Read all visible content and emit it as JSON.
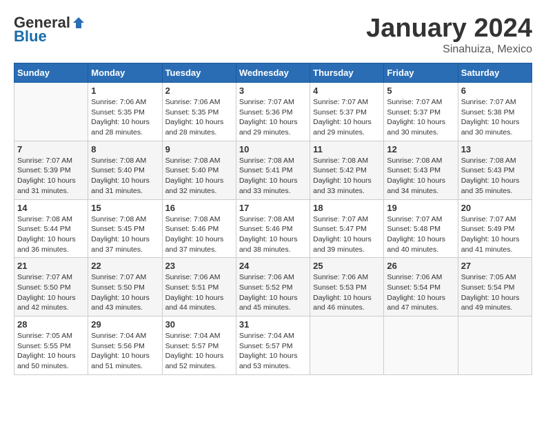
{
  "header": {
    "logo_general": "General",
    "logo_blue": "Blue",
    "month_year": "January 2024",
    "location": "Sinahuiza, Mexico"
  },
  "days_of_week": [
    "Sunday",
    "Monday",
    "Tuesday",
    "Wednesday",
    "Thursday",
    "Friday",
    "Saturday"
  ],
  "weeks": [
    [
      {
        "num": "",
        "sunrise": "",
        "sunset": "",
        "daylight": ""
      },
      {
        "num": "1",
        "sunrise": "Sunrise: 7:06 AM",
        "sunset": "Sunset: 5:35 PM",
        "daylight": "Daylight: 10 hours and 28 minutes."
      },
      {
        "num": "2",
        "sunrise": "Sunrise: 7:06 AM",
        "sunset": "Sunset: 5:35 PM",
        "daylight": "Daylight: 10 hours and 28 minutes."
      },
      {
        "num": "3",
        "sunrise": "Sunrise: 7:07 AM",
        "sunset": "Sunset: 5:36 PM",
        "daylight": "Daylight: 10 hours and 29 minutes."
      },
      {
        "num": "4",
        "sunrise": "Sunrise: 7:07 AM",
        "sunset": "Sunset: 5:37 PM",
        "daylight": "Daylight: 10 hours and 29 minutes."
      },
      {
        "num": "5",
        "sunrise": "Sunrise: 7:07 AM",
        "sunset": "Sunset: 5:37 PM",
        "daylight": "Daylight: 10 hours and 30 minutes."
      },
      {
        "num": "6",
        "sunrise": "Sunrise: 7:07 AM",
        "sunset": "Sunset: 5:38 PM",
        "daylight": "Daylight: 10 hours and 30 minutes."
      }
    ],
    [
      {
        "num": "7",
        "sunrise": "Sunrise: 7:07 AM",
        "sunset": "Sunset: 5:39 PM",
        "daylight": "Daylight: 10 hours and 31 minutes."
      },
      {
        "num": "8",
        "sunrise": "Sunrise: 7:08 AM",
        "sunset": "Sunset: 5:40 PM",
        "daylight": "Daylight: 10 hours and 31 minutes."
      },
      {
        "num": "9",
        "sunrise": "Sunrise: 7:08 AM",
        "sunset": "Sunset: 5:40 PM",
        "daylight": "Daylight: 10 hours and 32 minutes."
      },
      {
        "num": "10",
        "sunrise": "Sunrise: 7:08 AM",
        "sunset": "Sunset: 5:41 PM",
        "daylight": "Daylight: 10 hours and 33 minutes."
      },
      {
        "num": "11",
        "sunrise": "Sunrise: 7:08 AM",
        "sunset": "Sunset: 5:42 PM",
        "daylight": "Daylight: 10 hours and 33 minutes."
      },
      {
        "num": "12",
        "sunrise": "Sunrise: 7:08 AM",
        "sunset": "Sunset: 5:43 PM",
        "daylight": "Daylight: 10 hours and 34 minutes."
      },
      {
        "num": "13",
        "sunrise": "Sunrise: 7:08 AM",
        "sunset": "Sunset: 5:43 PM",
        "daylight": "Daylight: 10 hours and 35 minutes."
      }
    ],
    [
      {
        "num": "14",
        "sunrise": "Sunrise: 7:08 AM",
        "sunset": "Sunset: 5:44 PM",
        "daylight": "Daylight: 10 hours and 36 minutes."
      },
      {
        "num": "15",
        "sunrise": "Sunrise: 7:08 AM",
        "sunset": "Sunset: 5:45 PM",
        "daylight": "Daylight: 10 hours and 37 minutes."
      },
      {
        "num": "16",
        "sunrise": "Sunrise: 7:08 AM",
        "sunset": "Sunset: 5:46 PM",
        "daylight": "Daylight: 10 hours and 37 minutes."
      },
      {
        "num": "17",
        "sunrise": "Sunrise: 7:08 AM",
        "sunset": "Sunset: 5:46 PM",
        "daylight": "Daylight: 10 hours and 38 minutes."
      },
      {
        "num": "18",
        "sunrise": "Sunrise: 7:07 AM",
        "sunset": "Sunset: 5:47 PM",
        "daylight": "Daylight: 10 hours and 39 minutes."
      },
      {
        "num": "19",
        "sunrise": "Sunrise: 7:07 AM",
        "sunset": "Sunset: 5:48 PM",
        "daylight": "Daylight: 10 hours and 40 minutes."
      },
      {
        "num": "20",
        "sunrise": "Sunrise: 7:07 AM",
        "sunset": "Sunset: 5:49 PM",
        "daylight": "Daylight: 10 hours and 41 minutes."
      }
    ],
    [
      {
        "num": "21",
        "sunrise": "Sunrise: 7:07 AM",
        "sunset": "Sunset: 5:50 PM",
        "daylight": "Daylight: 10 hours and 42 minutes."
      },
      {
        "num": "22",
        "sunrise": "Sunrise: 7:07 AM",
        "sunset": "Sunset: 5:50 PM",
        "daylight": "Daylight: 10 hours and 43 minutes."
      },
      {
        "num": "23",
        "sunrise": "Sunrise: 7:06 AM",
        "sunset": "Sunset: 5:51 PM",
        "daylight": "Daylight: 10 hours and 44 minutes."
      },
      {
        "num": "24",
        "sunrise": "Sunrise: 7:06 AM",
        "sunset": "Sunset: 5:52 PM",
        "daylight": "Daylight: 10 hours and 45 minutes."
      },
      {
        "num": "25",
        "sunrise": "Sunrise: 7:06 AM",
        "sunset": "Sunset: 5:53 PM",
        "daylight": "Daylight: 10 hours and 46 minutes."
      },
      {
        "num": "26",
        "sunrise": "Sunrise: 7:06 AM",
        "sunset": "Sunset: 5:54 PM",
        "daylight": "Daylight: 10 hours and 47 minutes."
      },
      {
        "num": "27",
        "sunrise": "Sunrise: 7:05 AM",
        "sunset": "Sunset: 5:54 PM",
        "daylight": "Daylight: 10 hours and 49 minutes."
      }
    ],
    [
      {
        "num": "28",
        "sunrise": "Sunrise: 7:05 AM",
        "sunset": "Sunset: 5:55 PM",
        "daylight": "Daylight: 10 hours and 50 minutes."
      },
      {
        "num": "29",
        "sunrise": "Sunrise: 7:04 AM",
        "sunset": "Sunset: 5:56 PM",
        "daylight": "Daylight: 10 hours and 51 minutes."
      },
      {
        "num": "30",
        "sunrise": "Sunrise: 7:04 AM",
        "sunset": "Sunset: 5:57 PM",
        "daylight": "Daylight: 10 hours and 52 minutes."
      },
      {
        "num": "31",
        "sunrise": "Sunrise: 7:04 AM",
        "sunset": "Sunset: 5:57 PM",
        "daylight": "Daylight: 10 hours and 53 minutes."
      },
      {
        "num": "",
        "sunrise": "",
        "sunset": "",
        "daylight": ""
      },
      {
        "num": "",
        "sunrise": "",
        "sunset": "",
        "daylight": ""
      },
      {
        "num": "",
        "sunrise": "",
        "sunset": "",
        "daylight": ""
      }
    ]
  ]
}
